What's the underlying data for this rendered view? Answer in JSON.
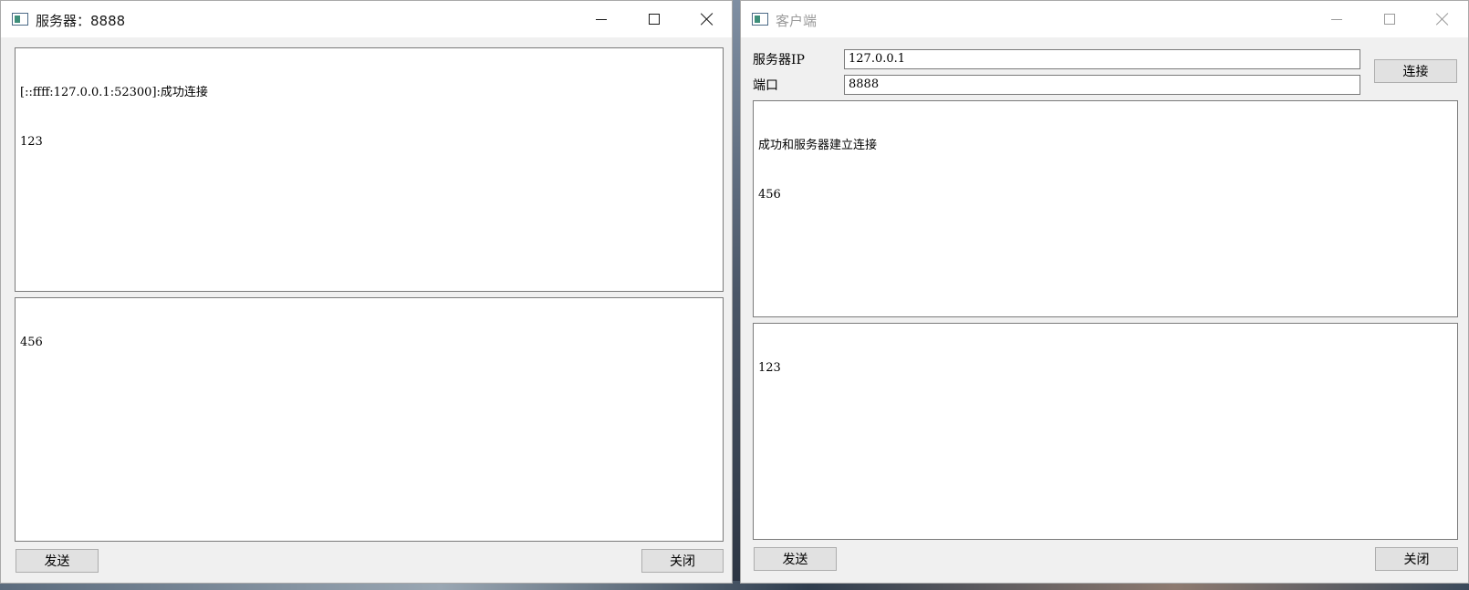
{
  "server_window": {
    "title": "服务器：8888",
    "log_lines": [
      "[::ffff:127.0.0.1:52300]:成功连接",
      "123"
    ],
    "input_text": "456",
    "send_label": "发送",
    "close_label": "关闭"
  },
  "client_window": {
    "title": "客户端",
    "ip_label": "服务器IP",
    "ip_value": "127.0.0.1",
    "port_label": "端口",
    "port_value": "8888",
    "connect_label": "连接",
    "log_lines": [
      "成功和服务器建立连接",
      "456"
    ],
    "input_text": "123",
    "send_label": "发送",
    "close_label": "关闭"
  },
  "icons": {
    "app": "app-window-icon",
    "minimize": "minimize-icon",
    "maximize": "maximize-icon",
    "close": "close-icon"
  },
  "colors": {
    "window_bg": "#f0f0f0",
    "titlebar_bg": "#ffffff",
    "button_bg": "#e1e1e1",
    "inactive_title": "#9a9a9a"
  }
}
